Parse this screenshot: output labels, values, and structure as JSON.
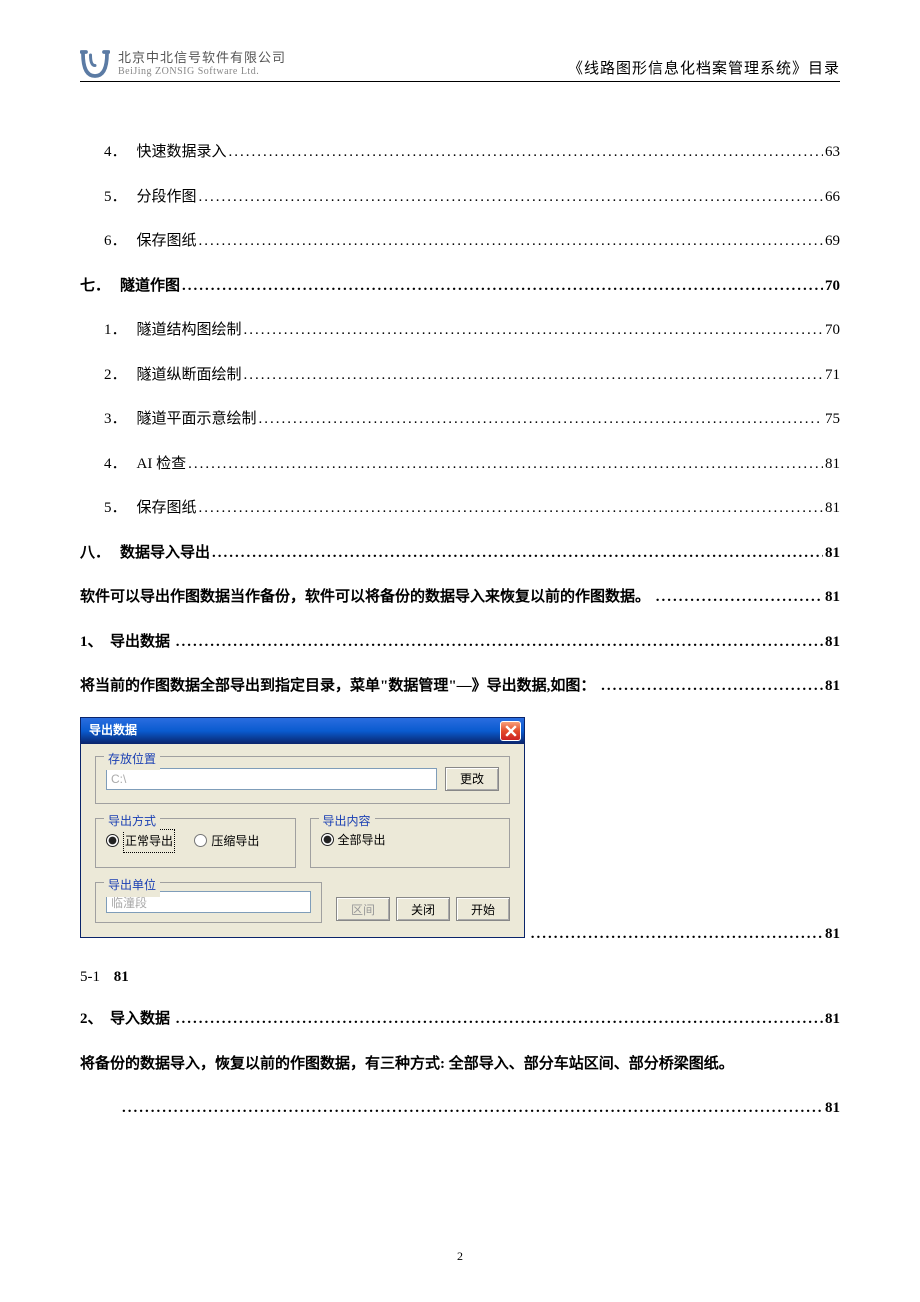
{
  "header": {
    "company_cn": "北京中北信号软件有限公司",
    "company_en": "BeiJing ZONSIG Software Ltd.",
    "doc_title": "《线路图形信息化档案管理系统》目录"
  },
  "toc": [
    {
      "indent": 1,
      "num": "4．",
      "title": "快速数据录入",
      "page": "63",
      "bold": false
    },
    {
      "indent": 1,
      "num": "5．",
      "title": "分段作图",
      "page": "66",
      "bold": false
    },
    {
      "indent": 1,
      "num": "6．",
      "title": "保存图纸",
      "page": "69",
      "bold": false
    },
    {
      "indent": 0,
      "num": "七．",
      "title": "隧道作图",
      "page": "70",
      "bold": true
    },
    {
      "indent": 1,
      "num": "1．",
      "title": "隧道结构图绘制",
      "page": "70",
      "bold": false
    },
    {
      "indent": 1,
      "num": "2．",
      "title": "隧道纵断面绘制",
      "page": "71",
      "bold": false
    },
    {
      "indent": 1,
      "num": "3．",
      "title": "隧道平面示意绘制",
      "page": "75",
      "bold": false
    },
    {
      "indent": 1,
      "num": "4．",
      "title": "AI 检查",
      "page": "81",
      "bold": false
    },
    {
      "indent": 1,
      "num": "5．",
      "title": "保存图纸",
      "page": "81",
      "bold": false
    },
    {
      "indent": 0,
      "num": "八．",
      "title": "数据导入导出",
      "page": "81",
      "bold": true
    }
  ],
  "para1": {
    "text": "软件可以导出作图数据当作备份，软件可以将备份的数据导入来恢复以前的作图数据。",
    "page": "81"
  },
  "item1": {
    "num": "1、",
    "title": "导出数据",
    "page": "81"
  },
  "para2": {
    "text": "将当前的作图数据全部导出到指定目录，菜单\"数据管理\"—》导出数据,如图：",
    "page": "81"
  },
  "cont1": {
    "page": "81"
  },
  "fig": {
    "label": "5-1",
    "page": "81"
  },
  "item2": {
    "num": "2、",
    "title": "导入数据",
    "page": "81"
  },
  "para3": {
    "text": "将备份的数据导入，恢复以前的作图数据，有三种方式: 全部导入、部分车站区间、部分桥梁图纸。"
  },
  "cont2": {
    "page": "81"
  },
  "dialog": {
    "title": "导出数据",
    "location_legend": "存放位置",
    "location_value": "C:\\",
    "change_btn": "更改",
    "method_legend": "导出方式",
    "method_normal": "正常导出",
    "method_compress": "压缩导出",
    "content_legend": "导出内容",
    "content_all": "全部导出",
    "unit_legend": "导出单位",
    "unit_value": "临潼段",
    "btn_range": "区间",
    "btn_close": "关闭",
    "btn_start": "开始"
  },
  "pagenum": "2"
}
